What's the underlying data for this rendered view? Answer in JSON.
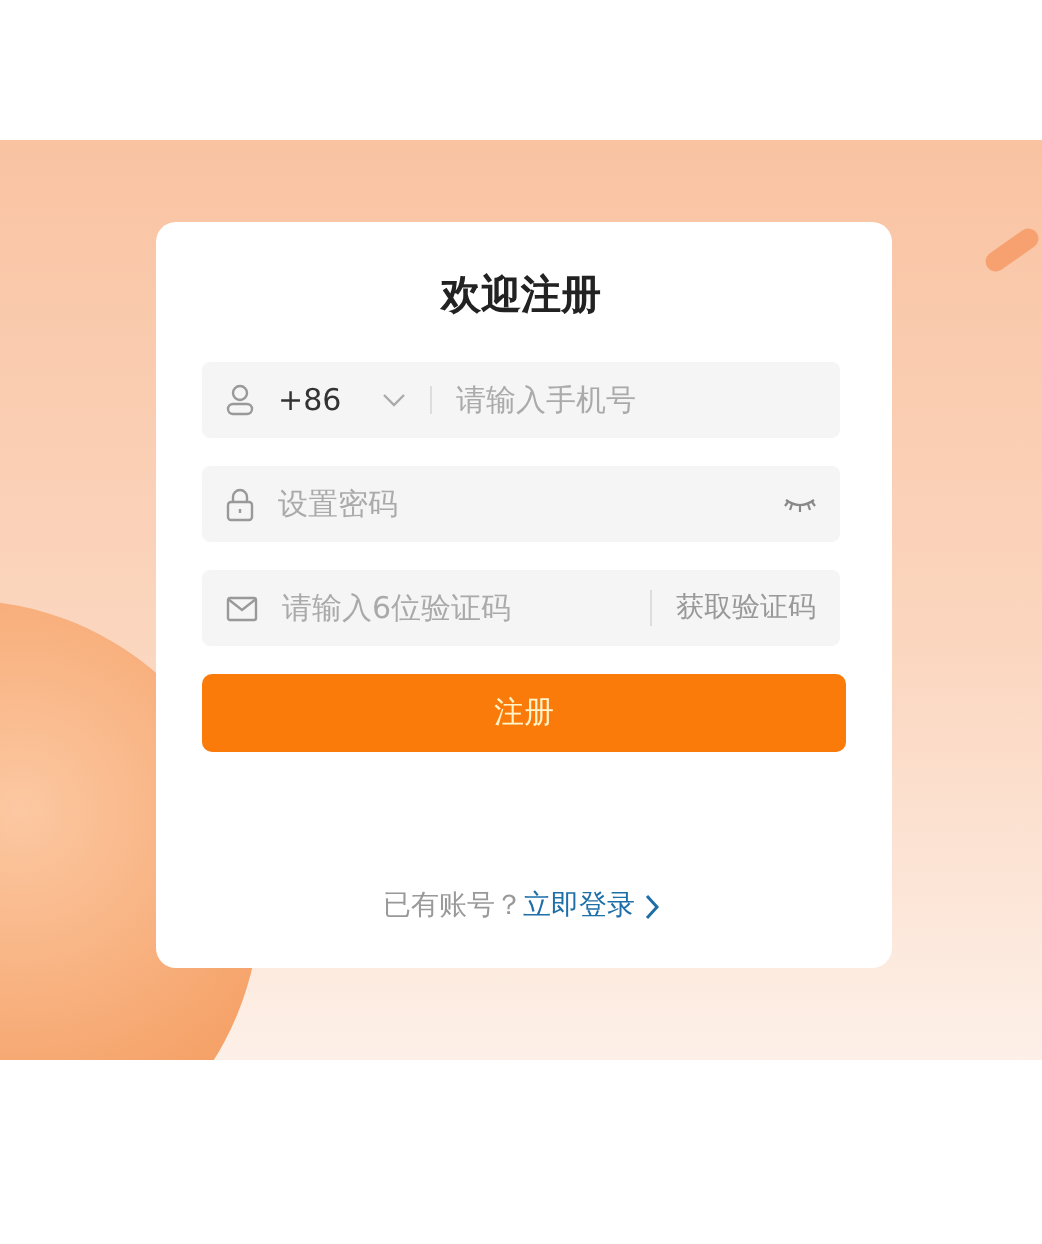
{
  "title": "欢迎注册",
  "fields": [
    {
      "kind": "phone",
      "country_code": "+86",
      "placeholder": "请输入手机号"
    },
    {
      "kind": "password",
      "placeholder": "设置密码"
    },
    {
      "kind": "code",
      "placeholder": "请输入6位验证码",
      "action": "获取验证码"
    }
  ],
  "submit": "注册",
  "footer": {
    "prompt": "已有账号？",
    "link": "立即登录"
  }
}
